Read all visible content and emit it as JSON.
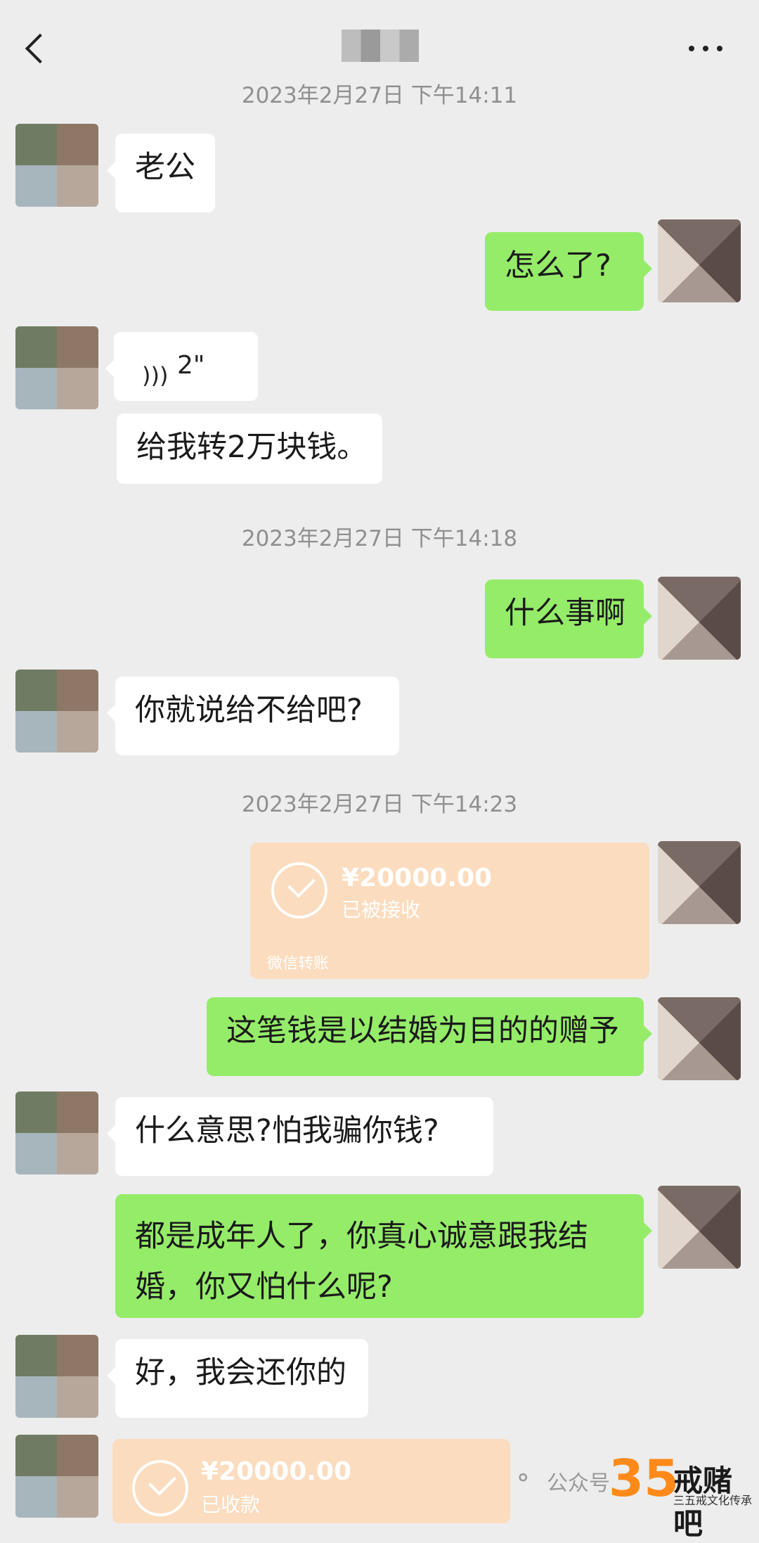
{
  "header": {
    "title": ""
  },
  "timestamps": [
    "2023年2月27日 下午14:11",
    "2023年2月27日 下午14:18",
    "2023年2月27日 下午14:23"
  ],
  "messages": [
    {
      "side": "left",
      "text": "老公"
    },
    {
      "side": "right",
      "text": "怎么了?"
    },
    {
      "side": "left",
      "type": "voice",
      "duration": "2\""
    },
    {
      "side": "left",
      "text": "给我转2万块钱。"
    },
    {
      "side": "right",
      "text": "什么事啊"
    },
    {
      "side": "left",
      "text": "你就说给不给吧?"
    },
    {
      "side": "right",
      "type": "transfer",
      "amount": "¥20000.00",
      "status": "已被接收",
      "footer": "微信转账"
    },
    {
      "side": "right",
      "text": "这笔钱是以结婚为目的的赠予"
    },
    {
      "side": "left",
      "text": "什么意思?怕我骗你钱?"
    },
    {
      "side": "right",
      "text": "都是成年人了，你真心诚意跟我结婚，你又怕什么呢?"
    },
    {
      "side": "left",
      "text": "好，我会还你的"
    },
    {
      "side": "left",
      "type": "transfer",
      "amount": "¥20000.00",
      "status": "已收款"
    }
  ],
  "watermark": {
    "account_label": "公众号",
    "logo_number": "35",
    "logo_text": "戒赌吧",
    "slogan": "三五戒文化传承"
  }
}
